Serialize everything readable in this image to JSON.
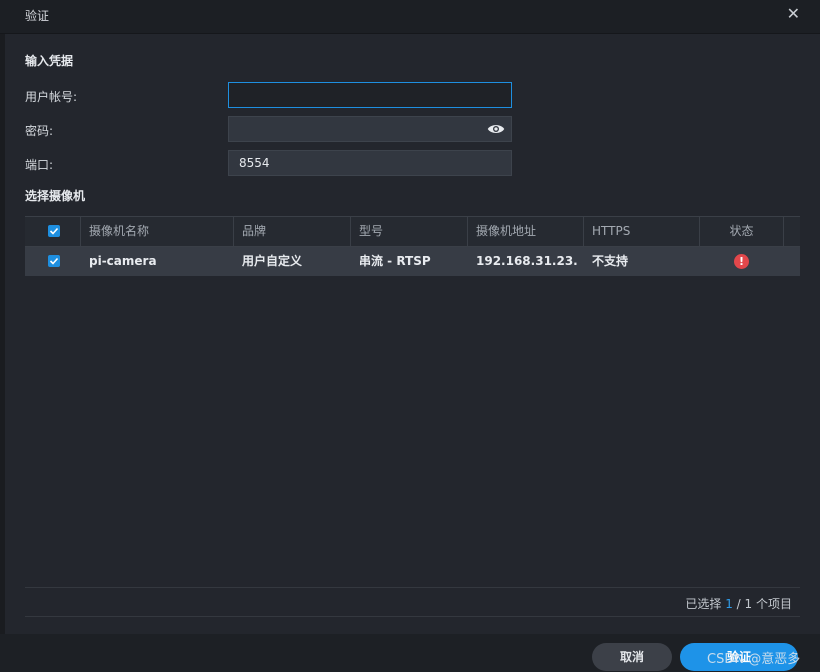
{
  "dialog": {
    "title": "验证",
    "close_glyph": "✕"
  },
  "credentials": {
    "section_title": "输入凭据",
    "username_label": "用户帐号:",
    "username_value": "",
    "password_label": "密码:",
    "password_value": "",
    "port_label": "端口:",
    "port_value": "8554"
  },
  "cameras": {
    "section_title": "选择摄像机",
    "columns": [
      "摄像机名称",
      "品牌",
      "型号",
      "摄像机地址",
      "HTTPS",
      "状态"
    ],
    "rows": [
      {
        "checked": true,
        "name": "pi-camera",
        "brand": "用户自定义",
        "model": "串流 - RTSP",
        "address": "192.168.31.23...",
        "https": "不支持",
        "status_icon": "error-icon",
        "status_glyph": "!"
      }
    ],
    "selection": {
      "prefix": "已选择",
      "selected": "1",
      "separator": "/",
      "total": "1 个项目"
    }
  },
  "buttons": {
    "cancel": "取消",
    "ok": "验证"
  },
  "watermark": "CSDN @意恶多",
  "colors": {
    "accent": "#1e93e8",
    "error": "#e2474b",
    "background": "#23262d"
  }
}
